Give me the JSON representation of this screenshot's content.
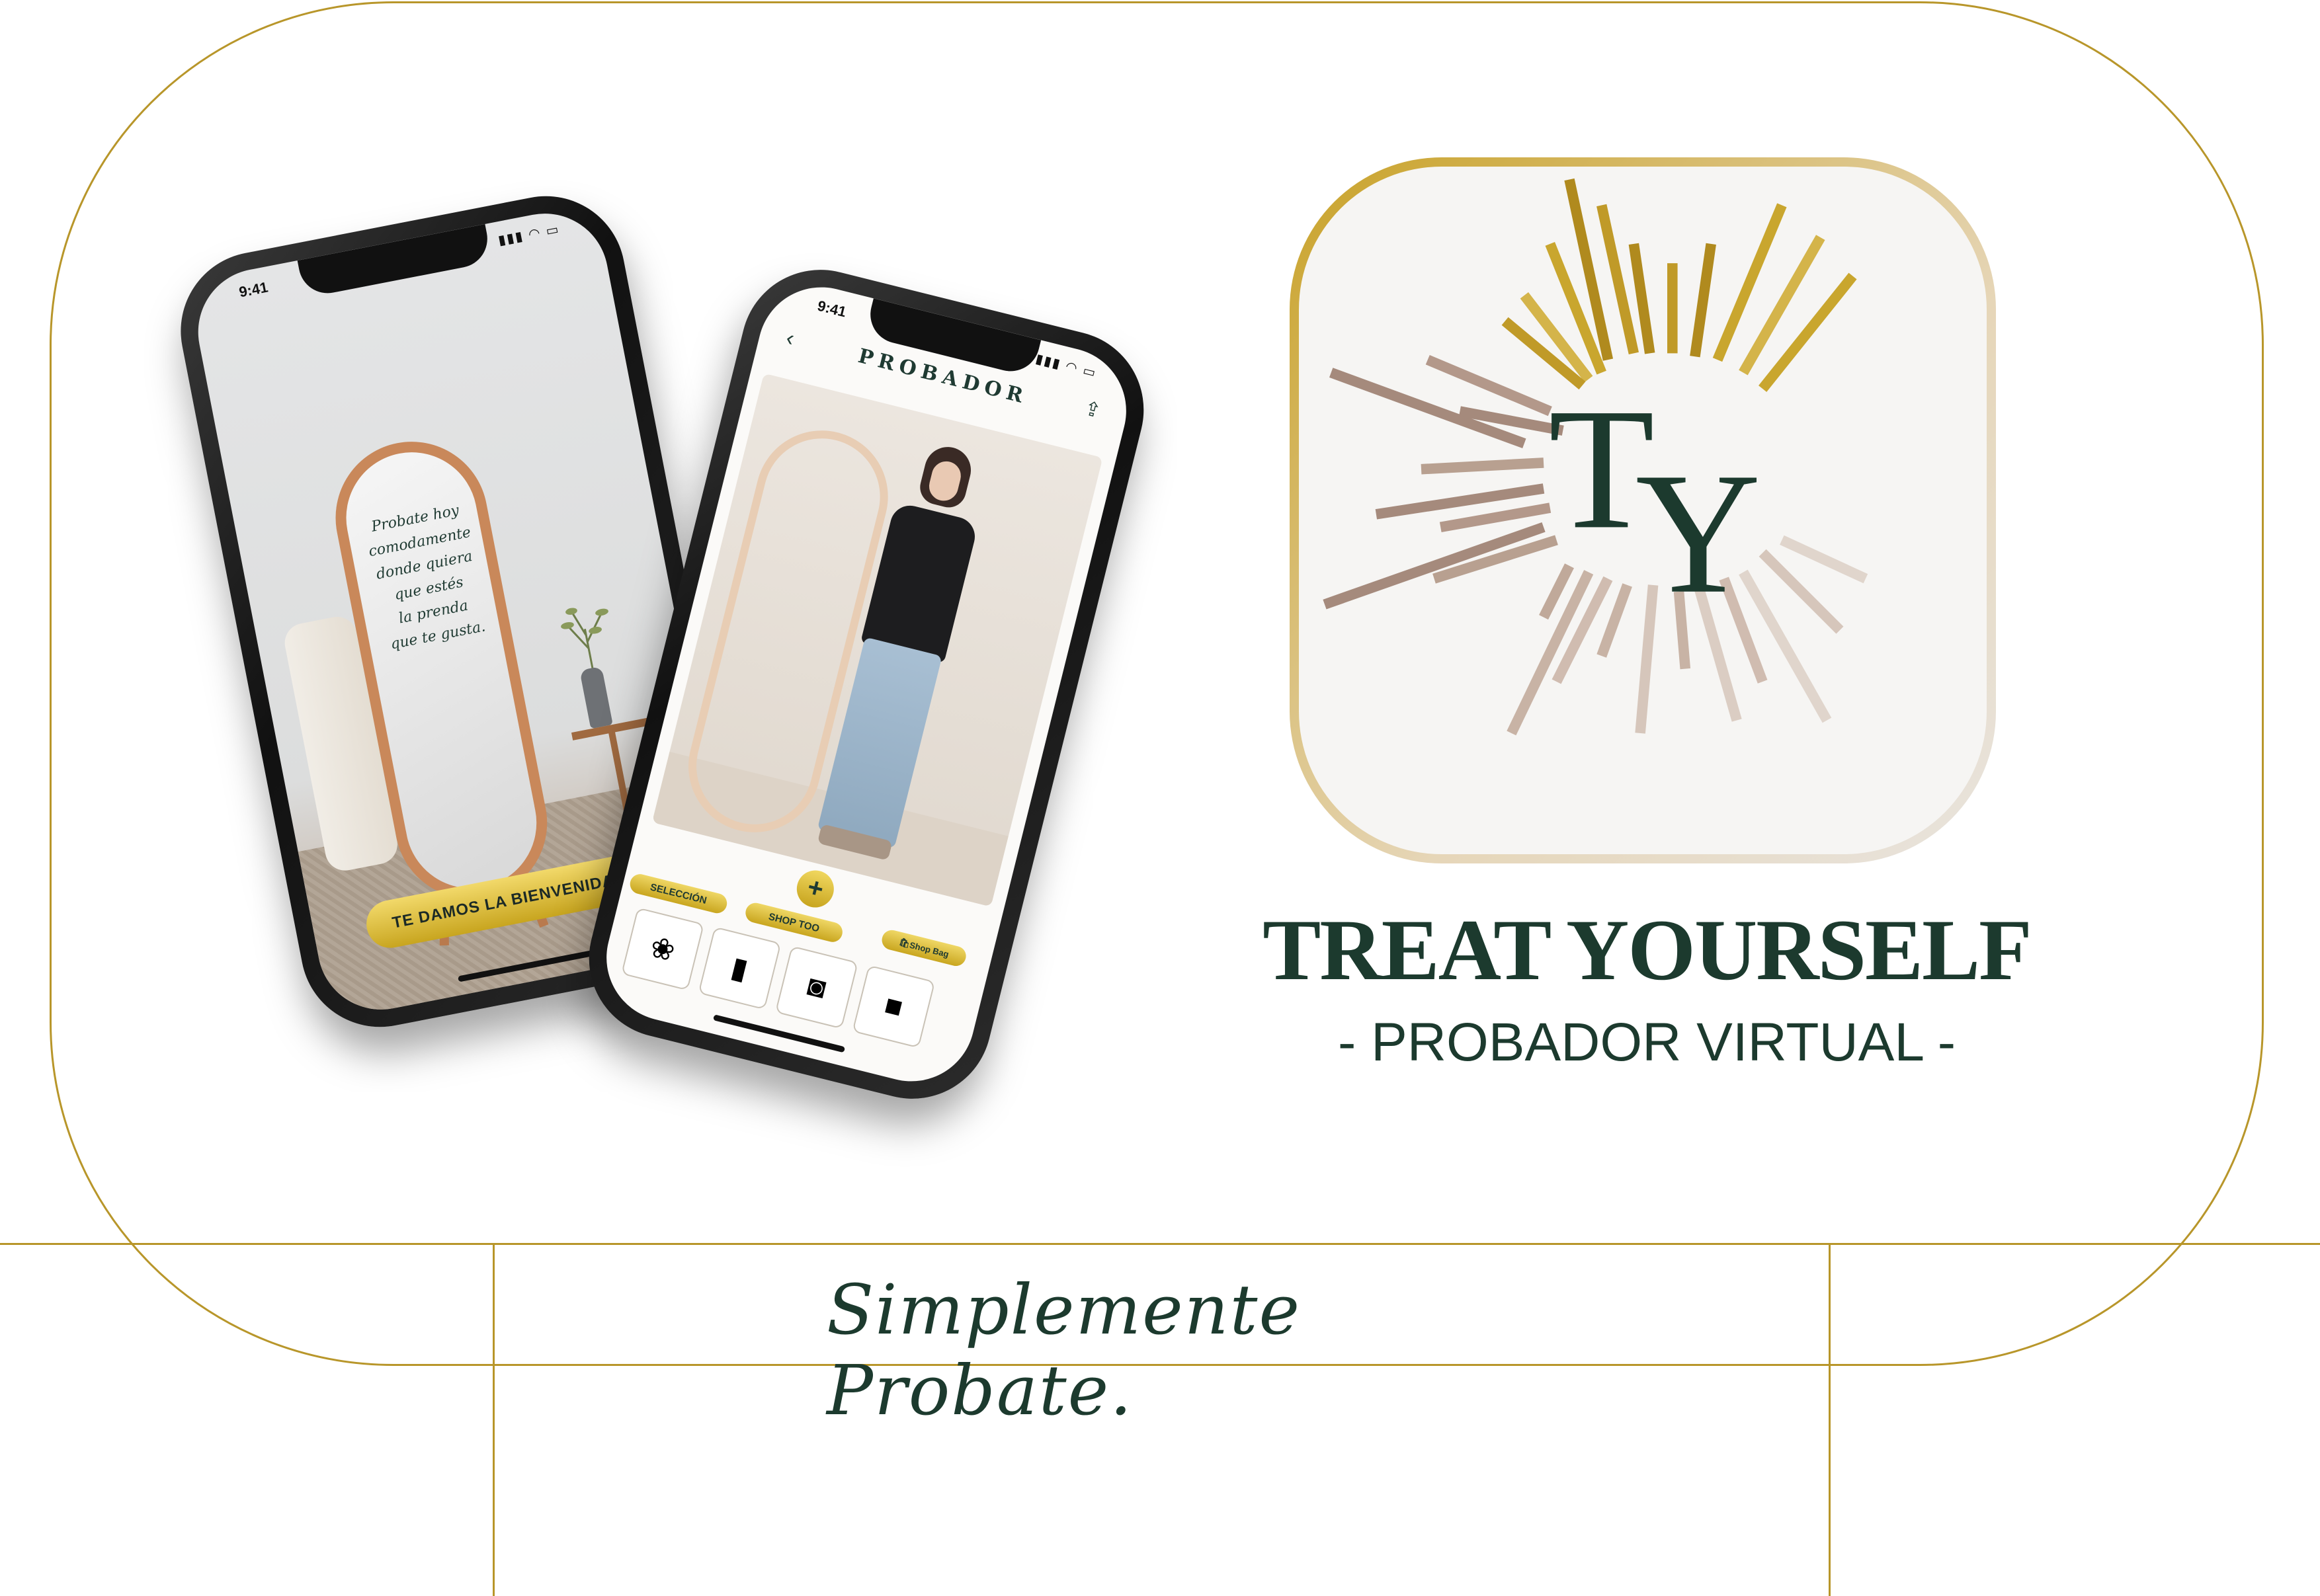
{
  "brand": {
    "title": "TREAT YOURSELF",
    "subtitle": "- PROBADOR VIRTUAL -",
    "tagline": "Simplemente Probate.",
    "monogram_t": "T",
    "monogram_y": "Y"
  },
  "colors": {
    "gold": "#b8962a",
    "dark_green": "#1c3a2e",
    "mauve": "#a58a7c"
  },
  "phone1": {
    "time": "9:41",
    "mirror_lines": [
      "Probate hoy",
      "comodamente",
      "donde quiera",
      "que estés",
      "la prenda",
      "que te gusta."
    ],
    "welcome_button": "TE DAMOS LA BIENVENIDA"
  },
  "phone2": {
    "time": "9:41",
    "header": "PROBADOR",
    "tab_selection": "SELECCIÓN",
    "tab_shop": "SHOP TOO",
    "shop_bag": "Shop Bag",
    "thumbnails": [
      "floral-shirt",
      "jeans",
      "belt",
      "black-jacket"
    ]
  },
  "icons": {
    "back": "back-arrow-icon",
    "share": "share-icon",
    "add": "plus-icon",
    "bag": "shopping-bag-icon"
  }
}
